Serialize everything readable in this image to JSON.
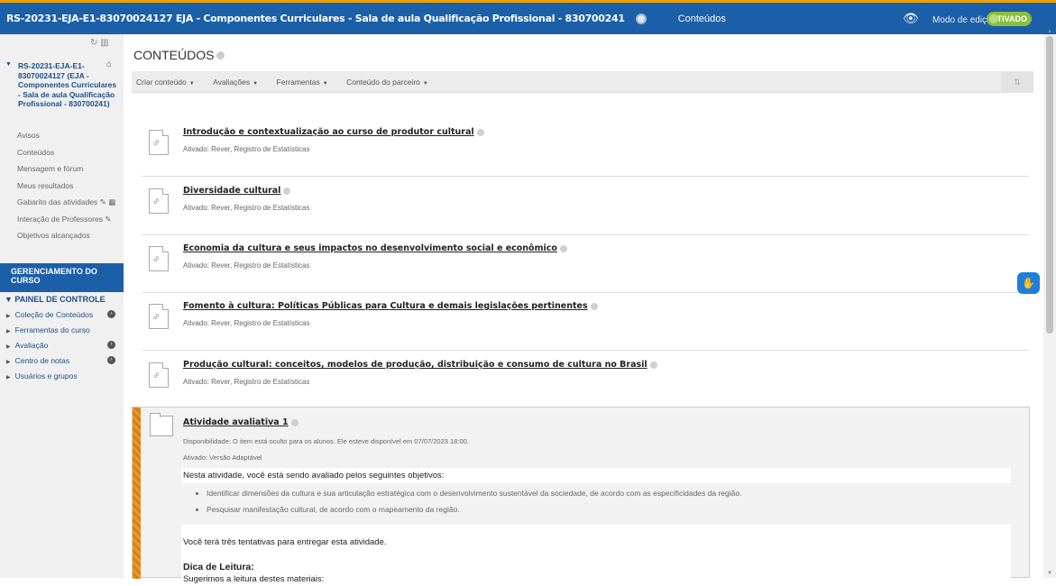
{
  "topbar": {
    "course_title": "RS-20231-EJA-E1-83070024127 EJA - Componentes Curriculares - Sala de aula Qualificação Profissional - 830700241",
    "breadcrumb": "Conteúdos",
    "edit_mode_label": "Modo de edição é:",
    "edit_mode_state": "ATIVADO",
    "accent": "#1b5fa8"
  },
  "sidebar": {
    "course_name": "RS-20231-EJA-E1-83070024127 (EJA - Componentes Curriculares - Sala de aula Qualificação Profissional - 830700241)",
    "menu": [
      "Avisos",
      "Conteúdos",
      "Mensagem e fórum",
      "Meus resultados",
      "Gabarito das atividades",
      "Interação de Professores",
      "Objetivos alcançados"
    ],
    "management_title": "GERENCIAMENTO DO CURSO",
    "panel_title": "PAINEL DE CONTROLE",
    "panel_items": [
      "Coleção de Conteúdos",
      "Ferramentas do curso",
      "Avaliação",
      "Centro de notas",
      "Usuários e grupos"
    ]
  },
  "main": {
    "page_title": "CONTEÚDOS",
    "actions": [
      "Criar conteúdo",
      "Avaliações",
      "Ferramentas",
      "Conteúdo do parceiro"
    ],
    "items": [
      {
        "title": "Introdução e contextualização ao curso de produtor cultural",
        "meta": "Ativado:  Rever, Registro de Estatísticas"
      },
      {
        "title": "Diversidade cultural",
        "meta": "Ativado:  Rever, Registro de Estatísticas"
      },
      {
        "title": "Economia da cultura e seus impactos no desenvolvimento social e econômico",
        "meta": "Ativado:  Rever, Registro de Estatísticas"
      },
      {
        "title": "Fomento à cultura: Políticas Públicas para Cultura e demais legislações pertinentes",
        "meta": "Ativado:  Rever, Registro de Estatísticas"
      },
      {
        "title": "Produção cultural: conceitos, modelos de produção, distribuição e consumo de cultura no Brasil",
        "meta": "Ativado:  Rever, Registro de Estatísticas"
      }
    ],
    "activity": {
      "title": "Atividade avaliativa 1",
      "availability": "Disponibilidade:  O item está oculto para os alunos. Ele esteve disponível em 07/07/2023 18:00.",
      "enabled": "Ativado:  Versão Adaptável",
      "intro": "Nesta atividade, você está sendo avaliado pelos seguintes objetivos:",
      "objectives": [
        "Identificar dimensões da cultura e sua articulação estratégica com o desenvolvimento sustentável da sociedade, de acordo com as especificidades da região.",
        "Pesquisar manifestação cultural, de acordo com o mapeamento da região."
      ],
      "attempts": "Você terá três tentativas para entregar esta atividade.",
      "tip_title": "Dica de Leitura:",
      "tip_text": "Sugerimos a leitura destes materiais:"
    }
  }
}
